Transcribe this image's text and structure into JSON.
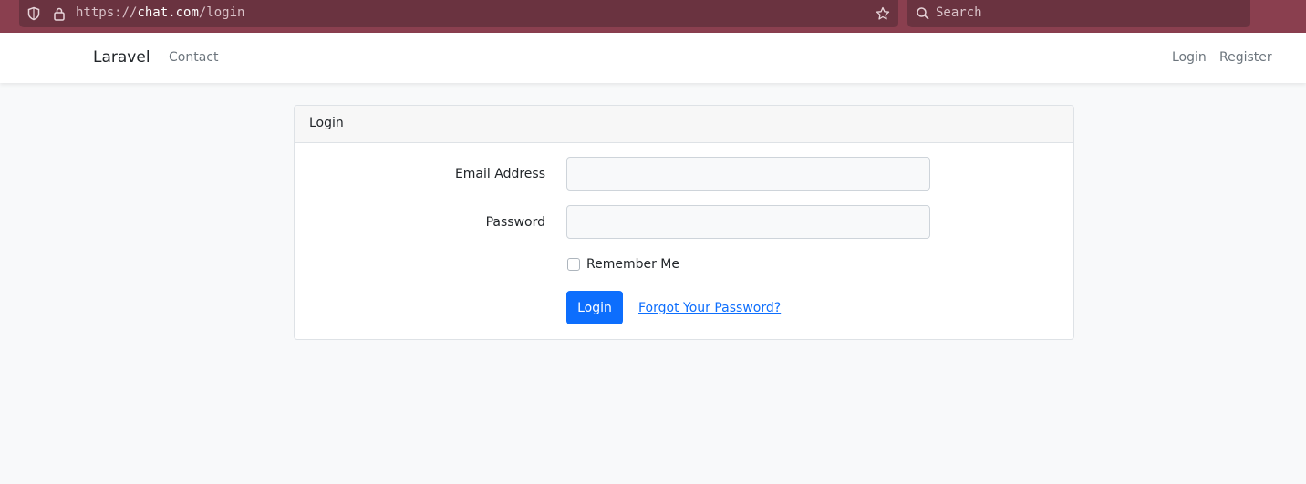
{
  "browser": {
    "url_scheme": "https://",
    "url_host": "chat.com",
    "url_path": "/login",
    "search_placeholder": "Search",
    "icons": [
      "shield-icon",
      "lock-icon",
      "star-icon",
      "search-icon"
    ]
  },
  "navbar": {
    "brand": "Laravel",
    "left_links": [
      "Contact"
    ],
    "right_links": [
      "Login",
      "Register"
    ]
  },
  "card": {
    "header": "Login",
    "email_label": "Email Address",
    "email_value": "",
    "password_label": "Password",
    "password_value": "",
    "remember_label": "Remember Me",
    "remember_checked": false,
    "submit_label": "Login",
    "forgot_link": "Forgot Your Password?"
  },
  "colors": {
    "chrome": "#8a3f4f",
    "primary": "#0d6efd",
    "background": "#f8f9fa"
  }
}
